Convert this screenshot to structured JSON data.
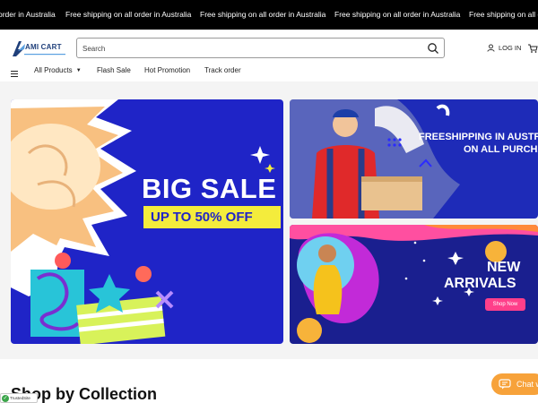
{
  "announcement": {
    "items": [
      "order in Australia",
      "Free shipping on all order in Australia",
      "Free shipping on all order in Australia",
      "Free shipping on all order in Australia",
      "Free shipping on all order in Australia"
    ]
  },
  "header": {
    "logo_text": "AMI CART",
    "search_placeholder": "Search",
    "login_label": "LOG IN"
  },
  "nav": {
    "items": [
      "All Products",
      "Flash Sale",
      "Hot Promotion",
      "Track order"
    ]
  },
  "banners": {
    "main": {
      "headline": "BIG SALE",
      "offer": "UP TO 50% OFF"
    },
    "shipping": {
      "line1": "FREESHIPPING IN AUSTR",
      "line2": "ON ALL PURCHA"
    },
    "arrivals": {
      "line1": "NEW",
      "line2": "ARRIVALS",
      "cta": "Shop Now"
    }
  },
  "section": {
    "title": "Shop by Collection"
  },
  "trusted": {
    "label": "TrustedSite"
  },
  "chat": {
    "label": "Chat w"
  },
  "colors": {
    "announcement_bg": "#000000",
    "banner_blue": "#1f24c7",
    "accent_yellow": "#f4ec3c",
    "chat_orange": "#f7a23a",
    "shop_now_pink": "#ff3f8a"
  }
}
